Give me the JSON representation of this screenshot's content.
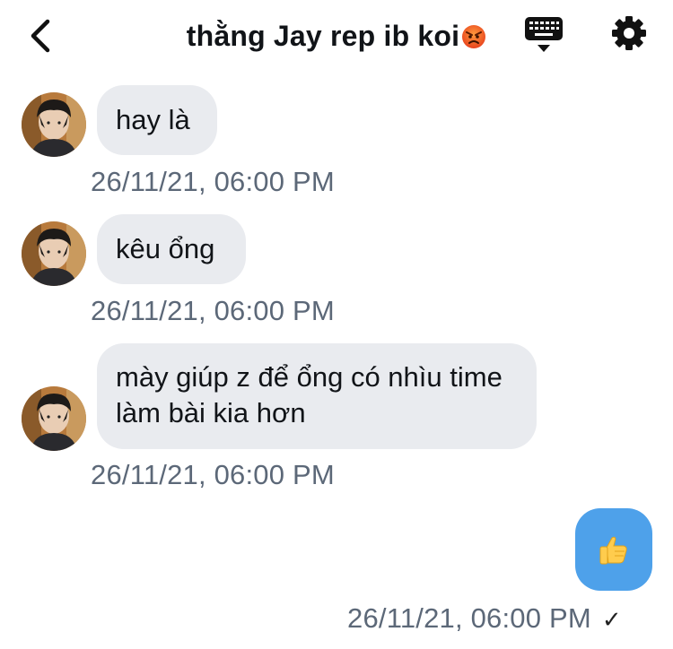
{
  "header": {
    "title": "thằng Jay rep ib koi",
    "title_emoji": "angry-face-emoji",
    "back_icon": "chevron-left-icon",
    "keyboard_icon": "keyboard-icon",
    "settings_icon": "gear-icon"
  },
  "messages": [
    {
      "text": "hay là",
      "timestamp": "26/11/21, 06:00 PM"
    },
    {
      "text": "kêu ổng",
      "timestamp": "26/11/21, 06:00 PM"
    },
    {
      "text": "mày giúp z để ổng có nhìu time làm bài kia hơn",
      "timestamp": "26/11/21, 06:00 PM"
    }
  ],
  "outgoing": {
    "content_icon": "thumbs-up-emoji",
    "timestamp": "26/11/21, 06:00 PM",
    "status": "✓"
  },
  "colors": {
    "incoming_bubble": "#e9ebef",
    "outgoing_bubble": "#4ea1ea",
    "timestamp": "#5c6878"
  }
}
